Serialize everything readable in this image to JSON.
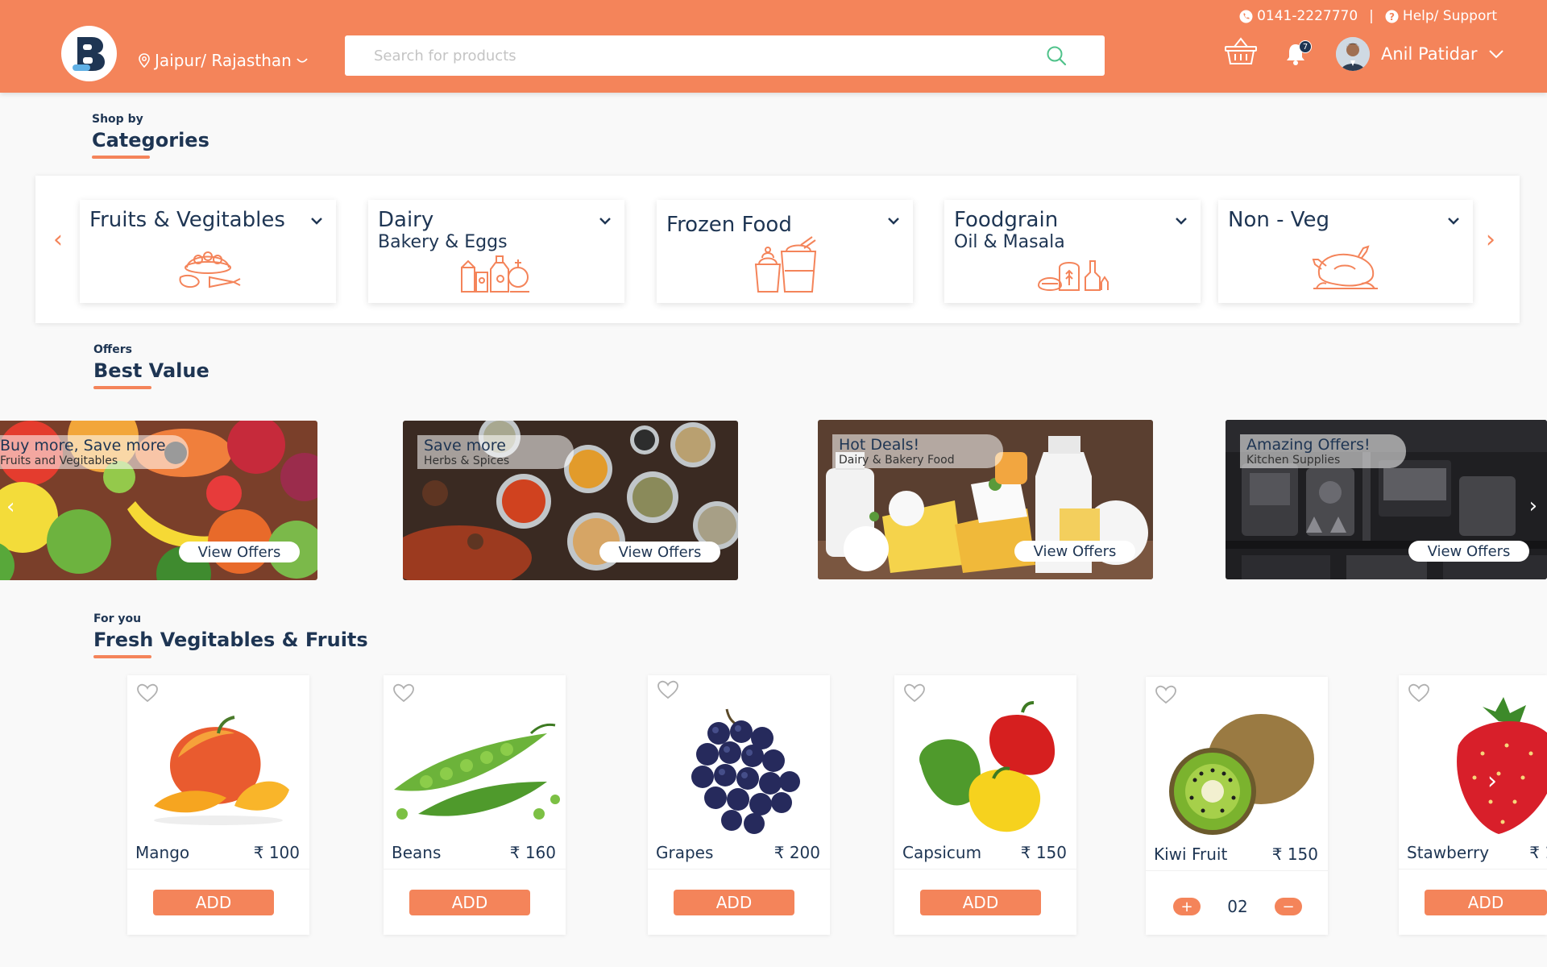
{
  "header": {
    "phone": "0141-2227770",
    "separator": "|",
    "help": "Help/ Support",
    "location": "Jaipur/ Rajasthan",
    "search_placeholder": "Search for products",
    "notification_count": "7",
    "user_name": "Anil Patidar"
  },
  "categories_section": {
    "small": "Shop by",
    "title": "Categories",
    "items": [
      {
        "name": "Fruits & Vegitables",
        "sub": "",
        "icon": "fruit-basket-icon"
      },
      {
        "name": "Dairy",
        "sub": "Bakery & Eggs",
        "icon": "dairy-icon"
      },
      {
        "name": "Frozen Food",
        "sub": "",
        "icon": "frozen-food-icon"
      },
      {
        "name": "Foodgrain",
        "sub": "Oil & Masala",
        "icon": "foodgrain-icon"
      },
      {
        "name": "Non - Veg",
        "sub": "",
        "icon": "chicken-icon"
      }
    ],
    "prev_arrow": "‹",
    "next_arrow": "›"
  },
  "offers_section": {
    "small": "Offers",
    "title": "Best Value",
    "items": [
      {
        "title": "Buy more, Save more",
        "sub": "Fruits and Vegitables",
        "button": "View Offers"
      },
      {
        "title": "Save more",
        "sub": "Herbs & Spices",
        "button": "View Offers"
      },
      {
        "title": "Hot Deals!",
        "sub": "Dairy & Bakery Food",
        "button": "View Offers"
      },
      {
        "title": "Amazing Offers!",
        "sub": "Kitchen Supplies",
        "button": "View Offers"
      }
    ]
  },
  "products_section": {
    "small": "For you",
    "title": "Fresh Vegitables & Fruits",
    "add_label": "ADD",
    "items": [
      {
        "name": "Mango",
        "price": "₹ 100"
      },
      {
        "name": "Beans",
        "price": "₹ 160"
      },
      {
        "name": "Grapes",
        "price": "₹ 200"
      },
      {
        "name": "Capsicum",
        "price": "₹ 150"
      },
      {
        "name": "Kiwi Fruit",
        "price": "₹ 150",
        "qty": "02",
        "plus": "+",
        "minus": "−"
      },
      {
        "name": "Stawberry",
        "price": "₹ 1"
      }
    ]
  },
  "colors": {
    "accent": "#f4845a",
    "text": "#1e3553"
  }
}
